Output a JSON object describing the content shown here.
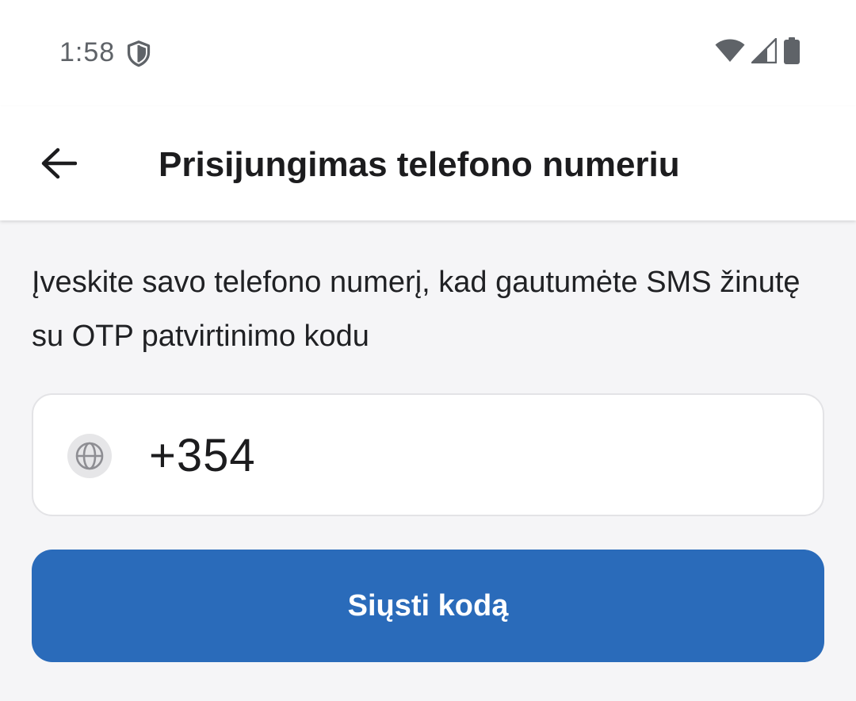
{
  "status_bar": {
    "time": "1:58",
    "icons": [
      "shield-icon",
      "wifi-icon",
      "signal-icon",
      "battery-icon"
    ],
    "icon_color": "#5f6368"
  },
  "app_bar": {
    "back_icon": "arrow-left-icon",
    "title": "Prisijungimas telefono numeriu"
  },
  "main": {
    "description": "Įveskite savo telefono numerį, kad gautumėte SMS žinutę su OTP patvirtinimo kodu",
    "phone_field": {
      "icon": "globe-icon",
      "value": "+354"
    },
    "send_button": {
      "label": "Siųsti kodą",
      "color": "#2a6bba"
    }
  },
  "colors": {
    "background": "#f5f5f7",
    "surface": "#ffffff",
    "primary": "#2a6bba",
    "text": "#1c1c1e"
  }
}
